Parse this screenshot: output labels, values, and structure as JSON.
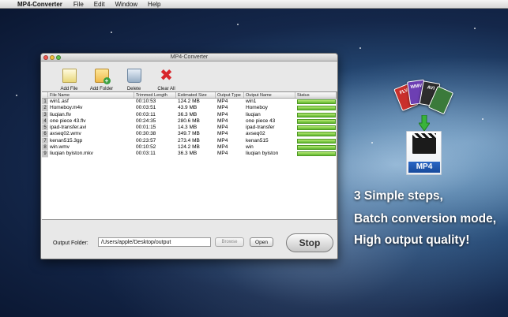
{
  "menubar": {
    "app_name": "MP4-Converter",
    "items": [
      "File",
      "Edit",
      "Window",
      "Help"
    ]
  },
  "window": {
    "title": "MP4-Converter"
  },
  "toolbar": {
    "add_file": "Add File",
    "add_folder": "Add Folder",
    "delete": "Delete",
    "clear_all": "Clear All"
  },
  "table": {
    "headers": [
      "File Name",
      "Trimmed Length",
      "Estimated Size",
      "Output Type",
      "Output Name",
      "Status"
    ],
    "rows": [
      {
        "num": "1",
        "file": "win1.asf",
        "trim": "00:10:53",
        "size": "124.2 MB",
        "type": "MP4",
        "name": "win1",
        "progress": 1.0
      },
      {
        "num": "2",
        "file": "Homeboy.m4v",
        "trim": "00:03:51",
        "size": "43.9 MB",
        "type": "MP4",
        "name": "Homeboy",
        "progress": 1.0
      },
      {
        "num": "3",
        "file": "liuqian.flv",
        "trim": "00:03:11",
        "size": "36.3 MB",
        "type": "MP4",
        "name": "liuqian",
        "progress": 1.0
      },
      {
        "num": "4",
        "file": "one piece 43.flv",
        "trim": "00:24:35",
        "size": "280.6 MB",
        "type": "MP4",
        "name": "one piece 43",
        "progress": 1.0
      },
      {
        "num": "5",
        "file": "ipad-transfer.avi",
        "trim": "00:01:15",
        "size": "14.3 MB",
        "type": "MP4",
        "name": "ipad-transfer",
        "progress": 1.0
      },
      {
        "num": "6",
        "file": "avseq02.wmv",
        "trim": "00:30:38",
        "size": "349.7 MB",
        "type": "MP4",
        "name": "avseq02",
        "progress": 1.0
      },
      {
        "num": "7",
        "file": "kenan515.3gp",
        "trim": "00:23:57",
        "size": "273.4 MB",
        "type": "MP4",
        "name": "kenan515",
        "progress": 1.0
      },
      {
        "num": "8",
        "file": "win.wmv",
        "trim": "00:10:52",
        "size": "124.2 MB",
        "type": "MP4",
        "name": "win",
        "progress": 1.0
      },
      {
        "num": "9",
        "file": "liuqian byiston.mkv",
        "trim": "00:03:11",
        "size": "36.3 MB",
        "type": "MP4",
        "name": "liuqian byiston",
        "progress": 1.0
      }
    ]
  },
  "bottom": {
    "output_label": "Output Folder:",
    "output_path": "/Users/apple/Desktop/output",
    "browse": "Browse",
    "open": "Open",
    "stop": "Stop"
  },
  "promo": {
    "line1": "3 Simple steps,",
    "line2": "Batch conversion mode,",
    "line3": "High output quality!",
    "badge": "MP4",
    "format_cards": [
      "FLV",
      "WMV",
      "AVI"
    ]
  },
  "colors": {
    "progress_green": "#5cb52a",
    "stop_red": "#d8262b",
    "mp4_blue": "#2a66c5"
  }
}
